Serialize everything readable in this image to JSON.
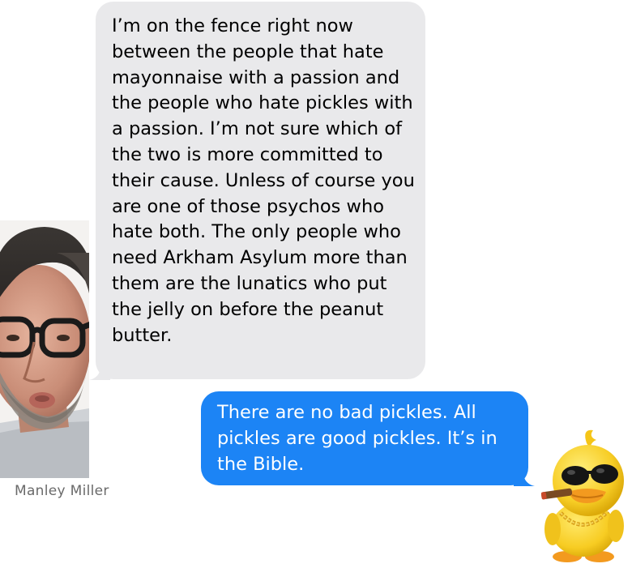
{
  "conversation": {
    "incoming": {
      "text": "I’m on the fence right now between the people that hate mayonnaise with a passion and the people who hate pickles with a passion. I’m not sure which of the two is more committed to their cause. Unless of course you are one of those psychos who hate both. The only people who need Arkham Asylum more than them are the lunatics who put the jelly on before the peanut butter.",
      "sender_name": "Manley Miller",
      "bubble_color": "#e9e9eb"
    },
    "outgoing": {
      "text": "There are no bad pickles. All pickles are good pickles. It’s in the Bible.",
      "bubble_color": "#1c84f5"
    }
  }
}
